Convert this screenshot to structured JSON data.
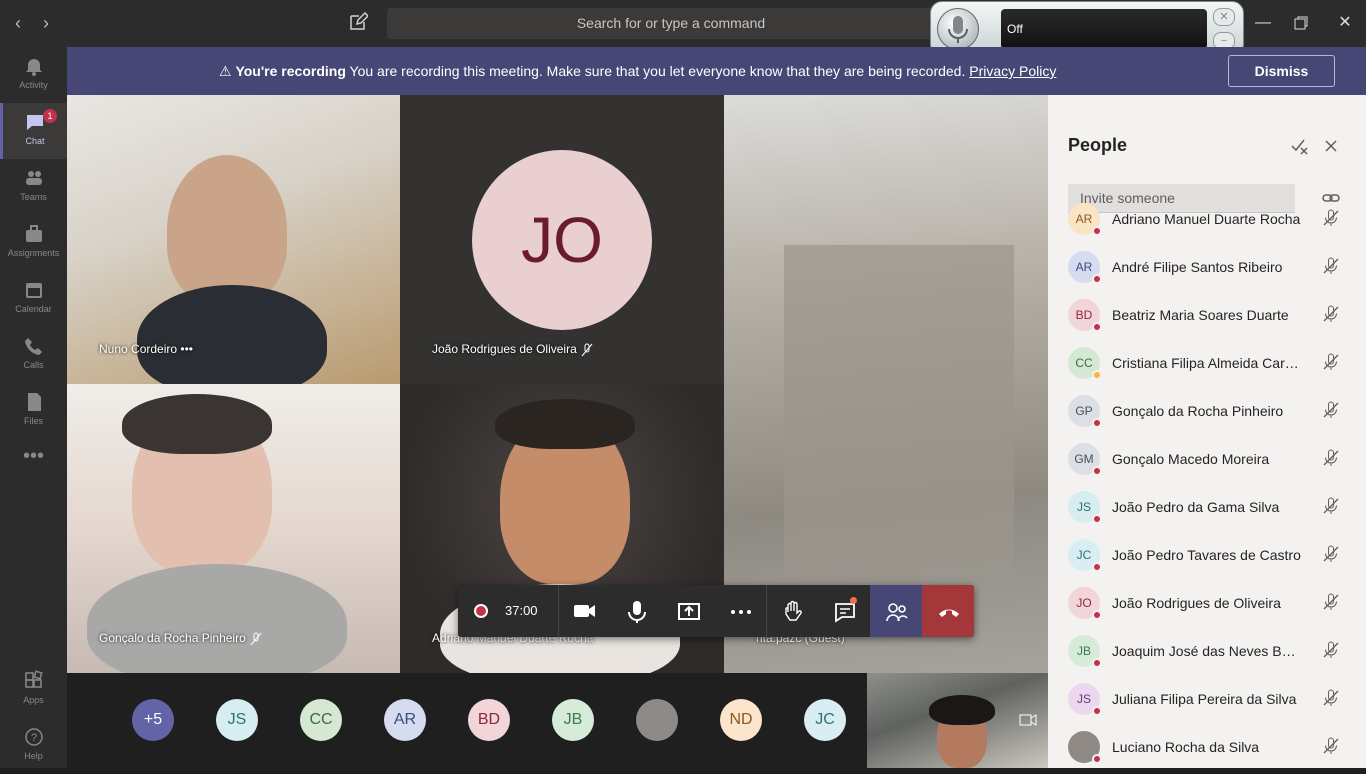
{
  "titlebar": {
    "search_placeholder": "Search for or type a command"
  },
  "mic_widget": {
    "status": "Off"
  },
  "rail": {
    "items": [
      {
        "label": "Activity"
      },
      {
        "label": "Chat",
        "badge": "1"
      },
      {
        "label": "Teams"
      },
      {
        "label": "Assignments"
      },
      {
        "label": "Calendar"
      },
      {
        "label": "Calls"
      },
      {
        "label": "Files"
      },
      {
        "label": "Apps"
      },
      {
        "label": "Help"
      }
    ]
  },
  "banner": {
    "title": "You're recording",
    "message": "You are recording this meeting. Make sure that you let everyone know that they are being recorded.",
    "link": "Privacy Policy",
    "dismiss": "Dismiss"
  },
  "tiles": [
    {
      "name": "Nuno Cordeiro"
    },
    {
      "name": "João Rodrigues de Oliveira",
      "initials": "JO"
    },
    {
      "name": "rita.pazc (Guest)"
    },
    {
      "name": "Gonçalo da Rocha Pinheiro"
    },
    {
      "name": "Adriano Manuel Duarte Rocha"
    }
  ],
  "controls": {
    "timer": "37:00"
  },
  "roster": {
    "overflow": "+5",
    "avatars": [
      {
        "initials": "JS",
        "bg": "#d7eef0",
        "fg": "#2f6f78"
      },
      {
        "initials": "CC",
        "bg": "#d5e8d4",
        "fg": "#3b6e3a"
      },
      {
        "initials": "AR",
        "bg": "#d6dcef",
        "fg": "#3b4a80"
      },
      {
        "initials": "BD",
        "bg": "#f1d5d9",
        "fg": "#8a2b3b"
      },
      {
        "initials": "JB",
        "bg": "#d6ebd9",
        "fg": "#3f7a4a"
      },
      {
        "initials": "",
        "bg": "#8f8a86",
        "fg": "#fff"
      },
      {
        "initials": "ND",
        "bg": "#fbe5cc",
        "fg": "#8a5a1f"
      },
      {
        "initials": "JC",
        "bg": "#d8eef3",
        "fg": "#2f6f78"
      }
    ]
  },
  "people": {
    "title": "People",
    "invite_placeholder": "Invite someone",
    "list": [
      {
        "initials": "AR",
        "name": "Adriano Manuel Duarte Rocha",
        "bg": "#fbe4c4",
        "fg": "#8a5a1f",
        "status": "busy"
      },
      {
        "initials": "AR",
        "name": "André Filipe Santos Ribeiro",
        "bg": "#d6dcef",
        "fg": "#3b4a80",
        "status": "busy"
      },
      {
        "initials": "BD",
        "name": "Beatriz Maria Soares Duarte",
        "bg": "#f1d5d9",
        "fg": "#8a2b3b",
        "status": "busy"
      },
      {
        "initials": "CC",
        "name": "Cristiana Filipa Almeida Carvalho",
        "bg": "#d5e8d4",
        "fg": "#3b6e3a",
        "status": "away"
      },
      {
        "initials": "GP",
        "name": "Gonçalo da Rocha Pinheiro",
        "bg": "#dcdfe3",
        "fg": "#45505b",
        "status": "busy"
      },
      {
        "initials": "GM",
        "name": "Gonçalo Macedo Moreira",
        "bg": "#dcdfe3",
        "fg": "#45505b",
        "status": "busy"
      },
      {
        "initials": "JS",
        "name": "João Pedro da Gama Silva",
        "bg": "#d7eef0",
        "fg": "#2f6f78",
        "status": "busy"
      },
      {
        "initials": "JC",
        "name": "João Pedro Tavares de Castro",
        "bg": "#d8eef3",
        "fg": "#2f6f78",
        "status": "busy"
      },
      {
        "initials": "JO",
        "name": "João Rodrigues de Oliveira",
        "bg": "#f1d5d9",
        "fg": "#8a2b3b",
        "status": "busy"
      },
      {
        "initials": "JB",
        "name": "Joaquim José das Neves Baptista",
        "bg": "#d6ebd9",
        "fg": "#3f7a4a",
        "status": "busy"
      },
      {
        "initials": "JS",
        "name": "Juliana Filipa Pereira da Silva",
        "bg": "#ecd8ee",
        "fg": "#6b3575",
        "status": "busy"
      },
      {
        "initials": "",
        "name": "Luciano Rocha da Silva",
        "bg": "#8f8a86",
        "fg": "#fff",
        "status": "busy"
      }
    ]
  },
  "colors": {
    "accent": "#6264a7",
    "banner": "#464775",
    "hangup": "#a4373a",
    "busy": "#c4314b",
    "away": "#fcb52e"
  }
}
